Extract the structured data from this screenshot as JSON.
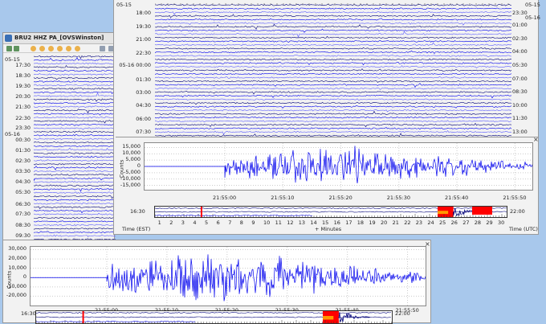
{
  "back_window": {
    "title": "BRU2 HHZ PA_[OVSWinston]",
    "toolbar_icons": [
      "export-icon",
      "copy-icon",
      "rewind-icon",
      "forward-icon",
      "compress-icon",
      "gear-icon",
      "scale-icon",
      "settings-icon",
      "zoom-in-icon",
      "zoom-out-icon",
      "save-icon"
    ],
    "date_labels": [
      "05-15",
      "05-16"
    ],
    "time_labels": [
      "17:30",
      "18:30",
      "19:30",
      "20:30",
      "21:30",
      "22:30",
      "23:30",
      "00:30",
      "01:30",
      "02:30",
      "03:30",
      "04:30",
      "05:30",
      "06:30",
      "07:30",
      "08:30",
      "09:30"
    ]
  },
  "front_window": {
    "left_date_top": "05-15",
    "left_labels": [
      "18:00",
      "19:30",
      "21:00",
      "22:30",
      "05-16 00:00",
      "01:30",
      "03:00",
      "04:30",
      "06:00",
      "07:30"
    ],
    "right_date_top": "05-15",
    "right_date_2": "05-16",
    "right_labels": [
      "23:30",
      "01:00",
      "02:30",
      "04:00",
      "05:30",
      "07:00",
      "08:30",
      "10:00",
      "11:30",
      "13:00"
    ],
    "zoom": {
      "y_label": "Counts",
      "y_ticks": [
        "15,000",
        "10,000",
        "5,000",
        "0",
        "-5,000",
        "-10,000",
        "-15,000"
      ],
      "x_ticks": [
        "21:55:00",
        "21:55:10",
        "21:55:20",
        "21:55:30",
        "21:55:40",
        "21:55:50"
      ],
      "mini_left": "16:30",
      "mini_right": "22:00",
      "minutes": [
        "1",
        "2",
        "3",
        "4",
        "5",
        "6",
        "7",
        "8",
        "9",
        "10",
        "11",
        "12",
        "13",
        "14",
        "15",
        "16",
        "17",
        "18",
        "19",
        "20",
        "21",
        "22",
        "23",
        "24",
        "25",
        "26",
        "27",
        "28",
        "29",
        "30"
      ],
      "time_left": "Time (EST)",
      "time_center": "+ Minutes",
      "time_right": "Time (UTC)",
      "close": "×"
    }
  },
  "bottom_window": {
    "last_row_label": "09:30",
    "y_label": "Counts",
    "y_ticks": [
      "30,000",
      "20,000",
      "10,000",
      "0",
      "-10,000",
      "-20,000"
    ],
    "x_ticks": [
      "21:55:00",
      "21:55:10",
      "21:55:20",
      "21:55:30",
      "21:55:40",
      "21:55:50"
    ],
    "mini_left": "16:30",
    "mini_right": "22:00",
    "close": "×"
  },
  "colors": {
    "trace_dark": "#00007a",
    "trace": "#0000ee",
    "trace_light": "#5c5cff",
    "event_red": "#ff0000",
    "event_orange": "#ff9900"
  }
}
